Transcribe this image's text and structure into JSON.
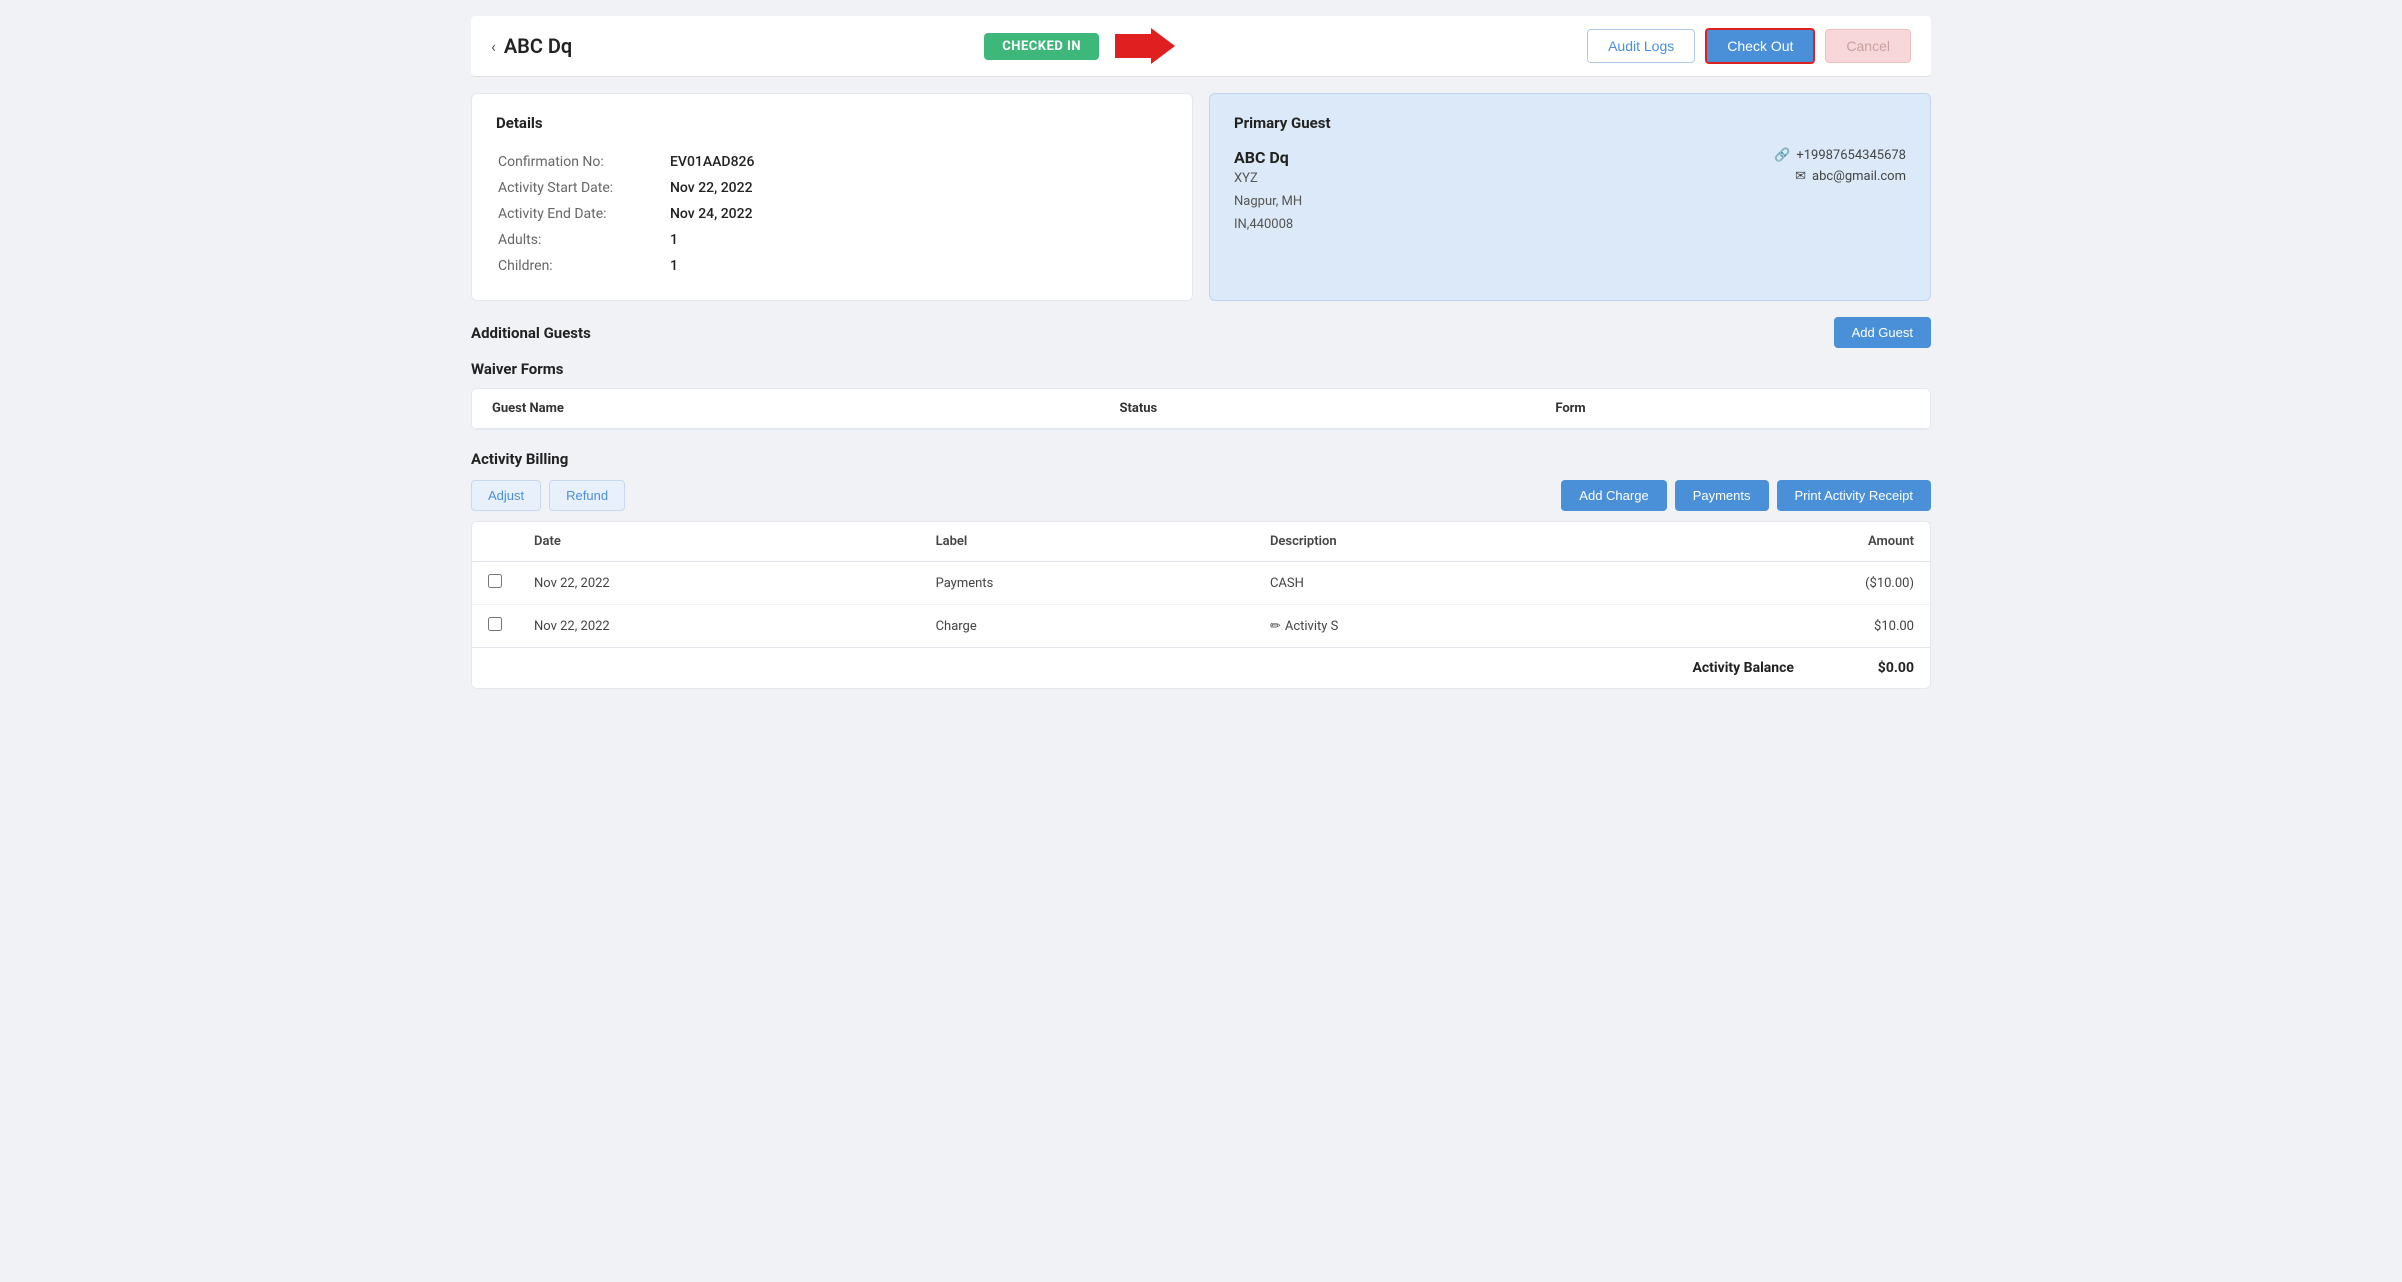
{
  "header": {
    "back_icon": "‹",
    "title": "ABC  Dq",
    "checked_in_label": "CHECKED IN",
    "audit_logs_label": "Audit Logs",
    "check_out_label": "Check Out",
    "cancel_label": "Cancel"
  },
  "details_card": {
    "title": "Details",
    "fields": [
      {
        "label": "Confirmation No:",
        "value": "EV01AAD826"
      },
      {
        "label": "Activity Start Date:",
        "value": "Nov 22, 2022"
      },
      {
        "label": "Activity End Date:",
        "value": "Nov 24, 2022"
      },
      {
        "label": "Adults:",
        "value": "1"
      },
      {
        "label": "Children:",
        "value": "1"
      }
    ]
  },
  "primary_guest_card": {
    "title": "Primary Guest",
    "name": "ABC  Dq",
    "org": "XYZ",
    "address_line1": "Nagpur, MH",
    "address_line2": "IN,440008",
    "phone_icon": "📞",
    "phone": "+19987654345678",
    "email_icon": "✉",
    "email": "abc@gmail.com"
  },
  "additional_guests": {
    "title": "Additional Guests",
    "add_guest_label": "Add Guest"
  },
  "waiver_forms": {
    "title": "Waiver Forms",
    "columns": [
      "Guest Name",
      "Status",
      "Form"
    ],
    "rows": []
  },
  "activity_billing": {
    "title": "Activity Billing",
    "adjust_label": "Adjust",
    "refund_label": "Refund",
    "add_charge_label": "Add Charge",
    "payments_label": "Payments",
    "print_receipt_label": "Print Activity Receipt",
    "columns": [
      "",
      "Date",
      "Label",
      "Description",
      "Amount"
    ],
    "rows": [
      {
        "checked": false,
        "date": "Nov 22, 2022",
        "label": "Payments",
        "description": "CASH",
        "amount": "($10.00)"
      },
      {
        "checked": false,
        "date": "Nov 22, 2022",
        "label": "Charge",
        "description": "Activity S",
        "amount": "$10.00",
        "has_edit": true
      }
    ],
    "balance_label": "Activity Balance",
    "balance_amount": "$0.00"
  }
}
